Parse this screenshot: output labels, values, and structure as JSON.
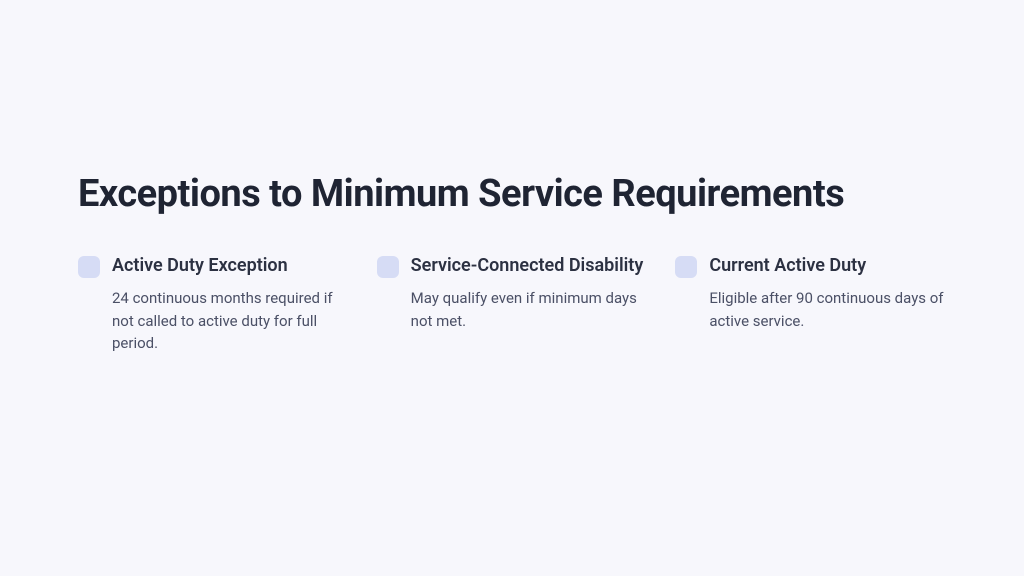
{
  "heading": "Exceptions to Minimum Service Requirements",
  "items": [
    {
      "title": "Active Duty Exception",
      "desc": "24 continuous months required if not called to active duty for full period."
    },
    {
      "title": "Service-Connected Disability",
      "desc": "May qualify even if minimum days not met."
    },
    {
      "title": "Current Active Duty",
      "desc": "Eligible after 90 continuous days of active service."
    }
  ]
}
